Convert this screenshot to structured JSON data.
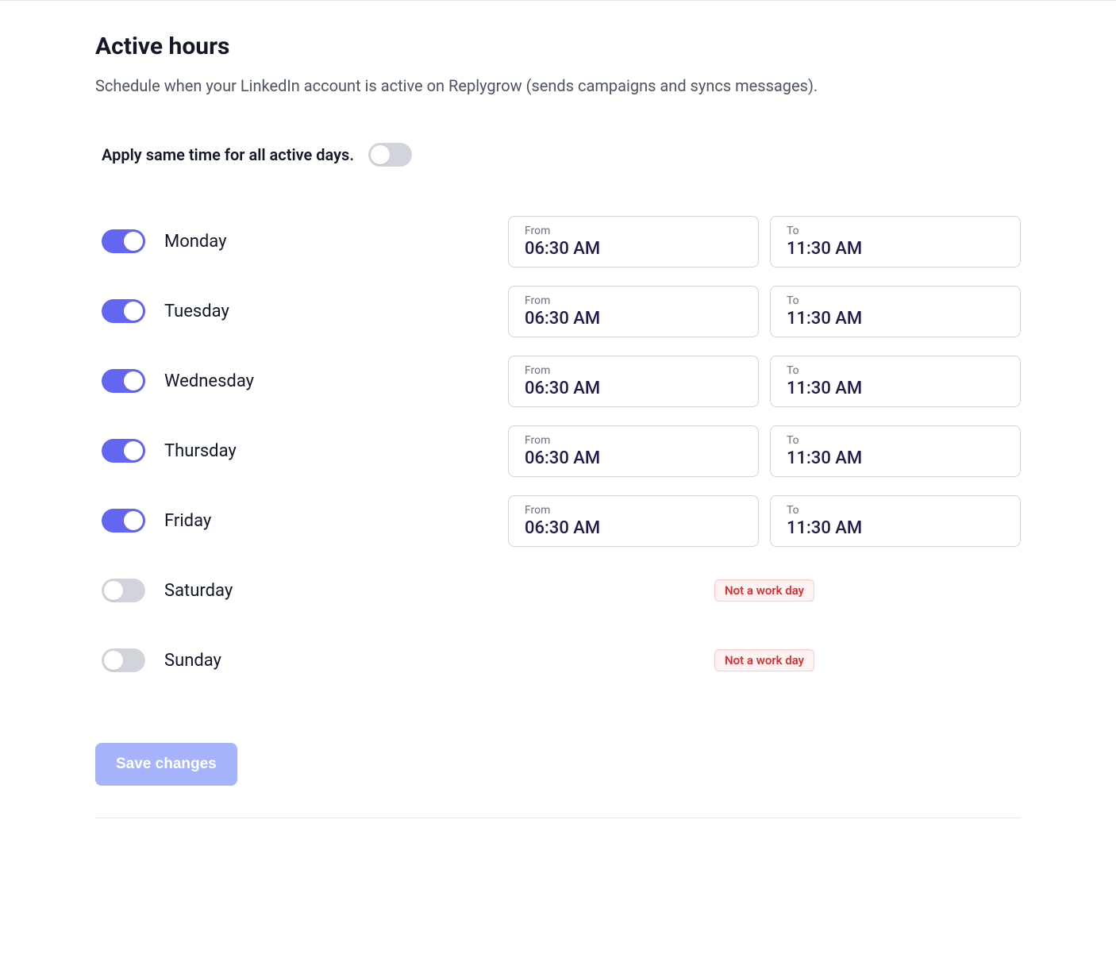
{
  "section": {
    "title": "Active hours",
    "description": "Schedule when your LinkedIn account is active on Replygrow (sends campaigns and syncs messages)."
  },
  "applySame": {
    "label": "Apply same time for all active days.",
    "enabled": false
  },
  "labels": {
    "from": "From",
    "to": "To",
    "notWorkDay": "Not a work day"
  },
  "days": [
    {
      "name": "Monday",
      "enabled": true,
      "from": "06:30 AM",
      "to": "11:30 AM"
    },
    {
      "name": "Tuesday",
      "enabled": true,
      "from": "06:30 AM",
      "to": "11:30 AM"
    },
    {
      "name": "Wednesday",
      "enabled": true,
      "from": "06:30 AM",
      "to": "11:30 AM"
    },
    {
      "name": "Thursday",
      "enabled": true,
      "from": "06:30 AM",
      "to": "11:30 AM"
    },
    {
      "name": "Friday",
      "enabled": true,
      "from": "06:30 AM",
      "to": "11:30 AM"
    },
    {
      "name": "Saturday",
      "enabled": false
    },
    {
      "name": "Sunday",
      "enabled": false
    }
  ],
  "actions": {
    "save": "Save changes"
  }
}
